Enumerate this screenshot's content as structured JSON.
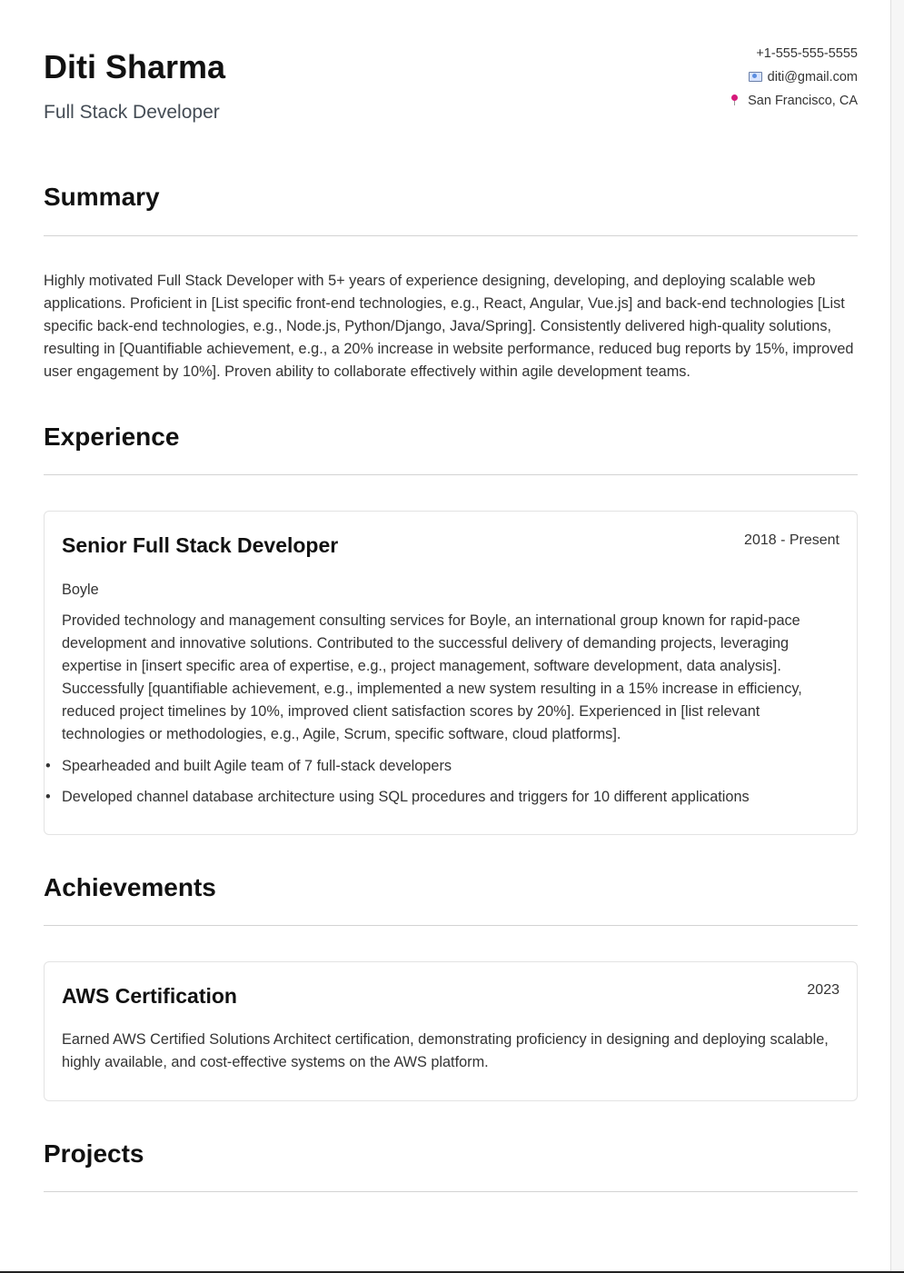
{
  "header": {
    "name": "Diti Sharma",
    "title": "Full Stack Developer",
    "phone": "+1-555-555-5555",
    "email": "diti@gmail.com",
    "location": "San Francisco, CA",
    "email_icon": "envelope-icon",
    "location_icon": "map-pin-icon"
  },
  "summary": {
    "heading": "Summary",
    "text": "Highly motivated Full Stack Developer with 5+ years of experience designing, developing, and deploying scalable web applications. Proficient in [List specific front-end technologies, e.g., React, Angular, Vue.js] and back-end technologies [List specific back-end technologies, e.g., Node.js, Python/Django, Java/Spring]. Consistently delivered high-quality solutions, resulting in [Quantifiable achievement, e.g., a 20% increase in website performance, reduced bug reports by 15%, improved user engagement by 10%]. Proven ability to collaborate effectively within agile development teams."
  },
  "experience": {
    "heading": "Experience",
    "items": [
      {
        "title": "Senior Full Stack Developer",
        "dates": "2018 - Present",
        "company": "Boyle",
        "description": "Provided technology and management consulting services for Boyle, an international group known for rapid-pace development and innovative solutions. Contributed to the successful delivery of demanding projects, leveraging expertise in [insert specific area of expertise, e.g., project management, software development, data analysis]. Successfully [quantifiable achievement, e.g., implemented a new system resulting in a 15% increase in efficiency, reduced project timelines by 10%, improved client satisfaction scores by 20%]. Experienced in [list relevant technologies or methodologies, e.g., Agile, Scrum, specific software, cloud platforms].",
        "bullets": [
          "Spearheaded and built Agile team of 7 full-stack developers",
          "Developed channel database architecture using SQL procedures and triggers for 10 different applications"
        ]
      }
    ]
  },
  "achievements": {
    "heading": "Achievements",
    "items": [
      {
        "title": "AWS Certification",
        "year": "2023",
        "description": "Earned AWS Certified Solutions Architect certification, demonstrating proficiency in designing and deploying scalable, highly available, and cost-effective systems on the AWS platform."
      }
    ]
  },
  "projects": {
    "heading": "Projects"
  }
}
